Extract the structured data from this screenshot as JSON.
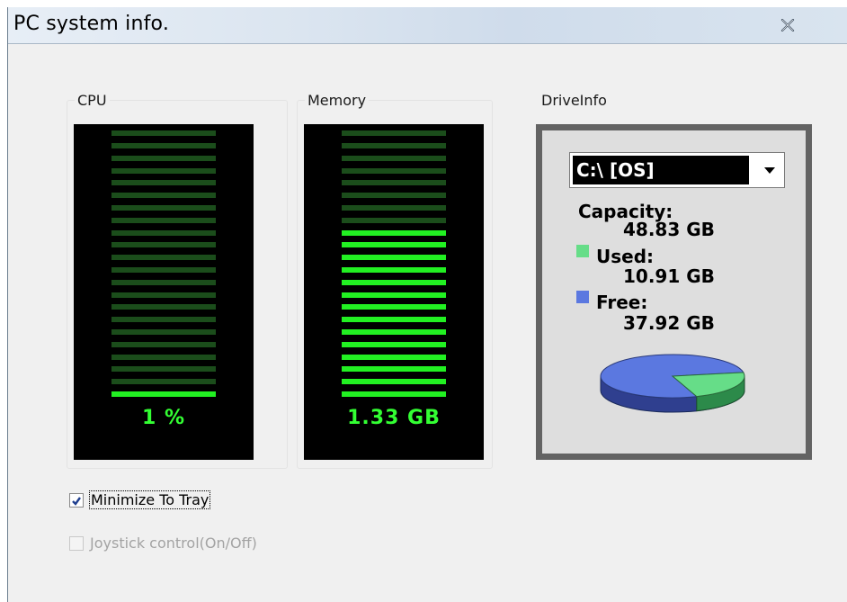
{
  "window": {
    "title": "PC system info.",
    "close_icon": "close-icon"
  },
  "cpu": {
    "label": "CPU",
    "value_text": "1 %",
    "bars_total": 22,
    "bars_lit": 1,
    "lit_color": "#22f022",
    "dim_color": "#1b4d1b"
  },
  "memory": {
    "label": "Memory",
    "value_text": "1.33 GB",
    "bars_total": 22,
    "bars_lit": 14,
    "lit_color": "#22f022",
    "dim_color": "#1b4d1b"
  },
  "drive": {
    "label": "DriveInfo",
    "selected": "C:\\ [OS]",
    "capacity_label": "Capacity:",
    "capacity_value": "48.83 GB",
    "used_label": "Used:",
    "used_value": "10.91 GB",
    "free_label": "Free:",
    "free_value": "37.92 GB",
    "used_color": "#66dd88",
    "free_color": "#5b78e0",
    "used_fraction": 0.2234
  },
  "options": {
    "minimize_to_tray": {
      "label": "Minimize To Tray",
      "checked": true,
      "enabled": true
    },
    "joystick": {
      "label": "Joystick control(On/Off)",
      "checked": false,
      "enabled": false
    }
  }
}
